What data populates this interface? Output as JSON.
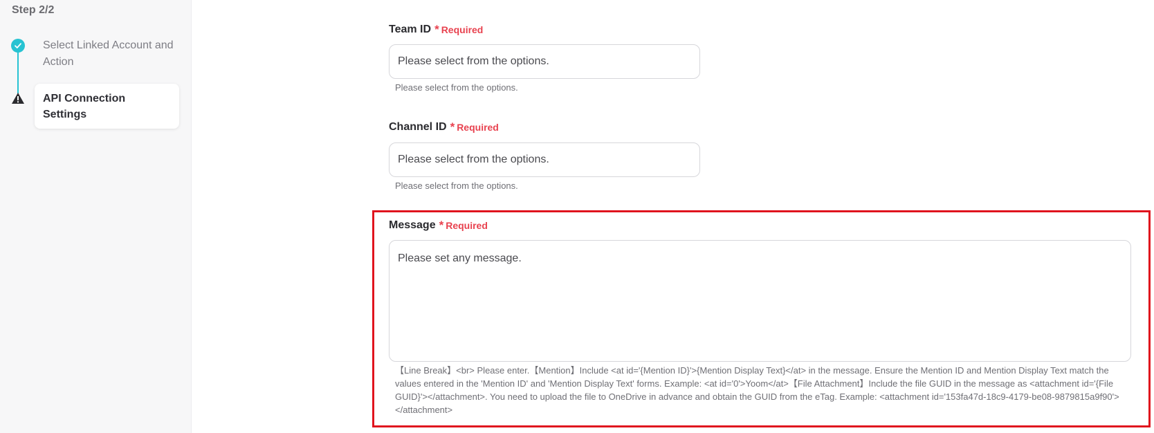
{
  "sidebar": {
    "step_title": "Step 2/2",
    "steps": [
      {
        "label": "Select Linked Account and Action",
        "status": "complete",
        "icon": "check-icon"
      },
      {
        "label": "API Connection Settings",
        "status": "warning",
        "icon": "warning-icon"
      }
    ]
  },
  "form": {
    "required_star": "*",
    "required_text": "Required",
    "team_id": {
      "label": "Team ID",
      "placeholder": "Please select from the options.",
      "hint": "Please select from the options."
    },
    "channel_id": {
      "label": "Channel ID",
      "placeholder": "Please select from the options.",
      "hint": "Please select from the options."
    },
    "message": {
      "label": "Message",
      "placeholder": "Please set any message.",
      "hint": "【Line Break】<br> Please enter.【Mention】Include <at id='{Mention ID}'>{Mention Display Text}</at> in the message. Ensure the Mention ID and Mention Display Text match the values entered in the 'Mention ID' and 'Mention Display Text' forms. Example: <at id='0'>Yoom</at>【File Attachment】Include the file GUID in the message as <attachment id='{File GUID}'></attachment>. You need to upload the file to OneDrive in advance and obtain the GUID from the eTag. Example: <attachment id='153fa47d-18c9-4179-be08-9879815a9f90'></attachment>"
    }
  },
  "colors": {
    "accent": "#27c3d2",
    "required": "#e8424f",
    "highlight_border": "#e0141e"
  }
}
